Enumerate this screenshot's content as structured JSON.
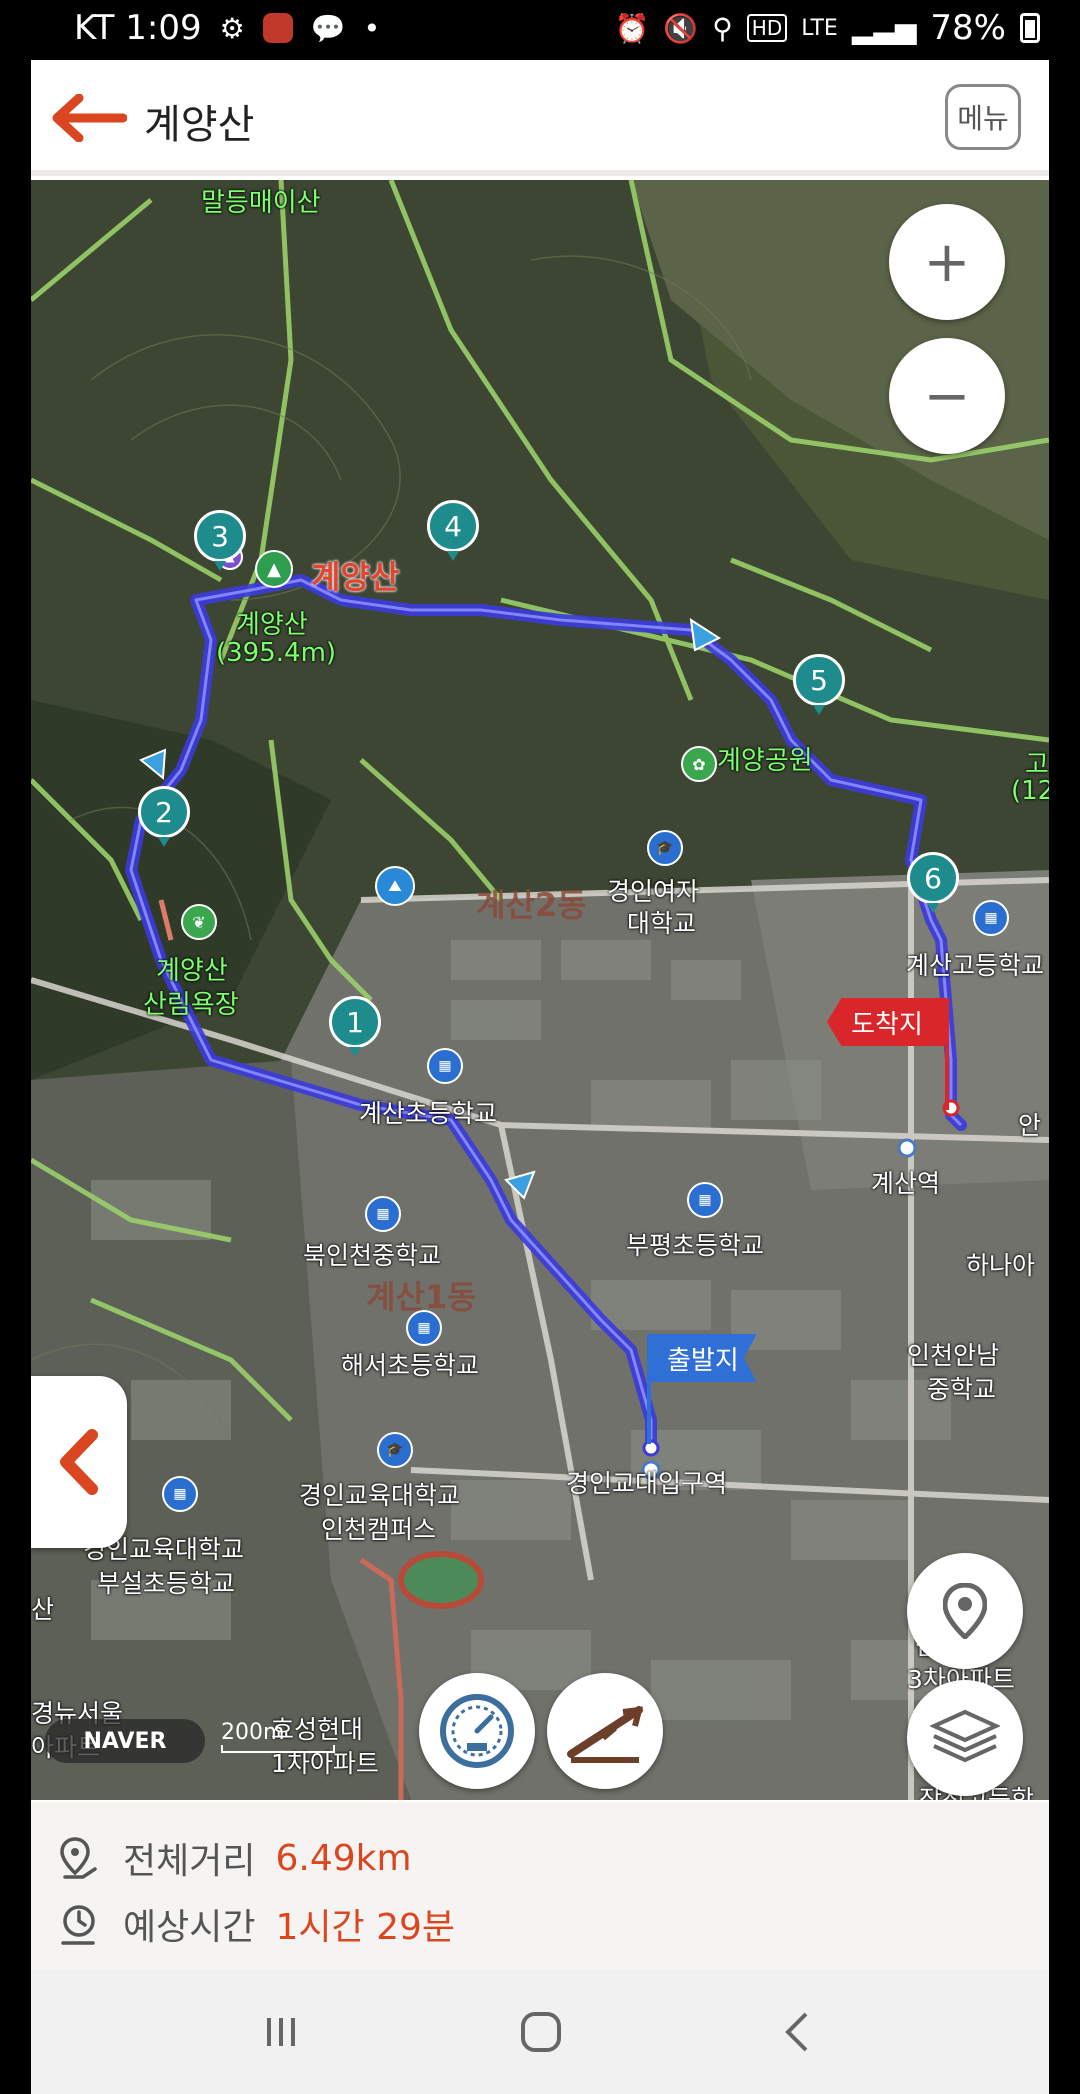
{
  "status_bar": {
    "carrier_time": "KT 1:09",
    "network": "LTE",
    "battery": "78%"
  },
  "header": {
    "title": "계양산",
    "menu_label": "메뉴"
  },
  "map": {
    "places": {
      "maldeung": "말등매이산",
      "gyeyangsan_red": "계양산",
      "gyeyangsan_peak": "계양산",
      "peak_height": "(395.4m)",
      "gyeyang_park": "계양공원",
      "gyesan2": "계산2동",
      "gyeongin_girls": "경인여자",
      "gyeongin_girls2": "대학교",
      "gyesan_high": "계산고등학교",
      "an": "안",
      "gyesan_elem": "계산초등학교",
      "gyesan_station": "계산역",
      "bukincheon_mid": "북인천중학교",
      "bupyeong_elem": "부평초등학교",
      "hana": "하나아",
      "gyesan1": "계산1동",
      "haeseo_elem": "해서초등학교",
      "incheon_anam": "인천안남",
      "incheon_anam2": "중학교",
      "edu_univ_station": "경인교대입구역",
      "edu_univ": "경인교육대학교",
      "edu_univ2": "인천캠퍼스",
      "edu_elem": "경인교육대학교",
      "edu_elem2": "부설초등학교",
      "forest_bath": "계양산",
      "forest_bath2": "산림욕장",
      "go": "고",
      "go2": "(12",
      "apt1": "효성현대",
      "apt2": "1차아파트",
      "left_label1": "경뉴서울",
      "left_label2": "아파트",
      "right_label1": "삼현타",
      "right_label2": "3차아파트",
      "bottom_right": "작전고등학",
      "san": "산"
    },
    "waypoints": [
      "1",
      "2",
      "3",
      "4",
      "5",
      "6"
    ],
    "start_flag": "출발지",
    "end_flag": "도착지",
    "naver": "NAVER",
    "scale": "200m"
  },
  "controls": {
    "zoom_in": "+",
    "zoom_out": "−"
  },
  "info": {
    "distance_label": "전체거리",
    "distance_value": "6.49km",
    "time_label": "예상시간",
    "time_value": "1시간 29분"
  },
  "icons": {
    "back": "arrow-left-icon",
    "location": "location-pin-icon",
    "layers": "layers-icon",
    "speed": "speedometer-icon",
    "slope": "slope-icon"
  },
  "colors": {
    "accent": "#d9461f",
    "route": "#3b3bdc",
    "waypoint": "#1e8c8c",
    "start_flag": "#2f6fd6",
    "end_flag": "#d9262b"
  }
}
